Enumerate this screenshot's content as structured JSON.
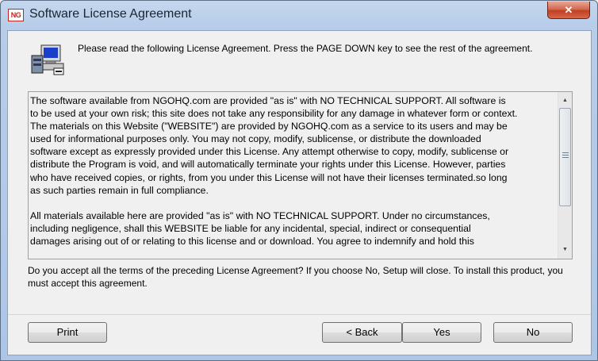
{
  "window": {
    "title": "Software License Agreement",
    "app_icon_text": "NG",
    "close_glyph": "✕"
  },
  "header": {
    "instructions": "Please read the following License Agreement. Press the PAGE DOWN key to see the rest of the agreement."
  },
  "license": {
    "paragraphs": [
      "The software available from NGOHQ.com are provided \"as is\" with NO TECHNICAL SUPPORT. All software is\nto be used at your own risk; this site does not take any responsibility for any damage in whatever form or context.\nThe materials on this Website (\"WEBSITE\") are provided by NGOHQ.com as a service to its users and may be\nused for informational purposes only. You may not copy, modify, sublicense, or distribute the downloaded\nsoftware except as expressly provided under this License. Any attempt otherwise to copy, modify, sublicense or\ndistribute the Program is void, and will automatically terminate your rights under this License. However, parties\nwho have received copies, or rights, from you under this License will not have their licenses terminated.so long\nas such parties remain in full compliance.",
      "All materials available here are provided \"as is\" with NO TECHNICAL SUPPORT. Under no circumstances,\nincluding negligence, shall this WEBSITE be liable for any incidental, special, indirect or consequential\ndamages arising out of or relating to this license and or download. You agree to indemnify and hold this"
    ],
    "scroll_up_glyph": "▲",
    "scroll_down_glyph": "▼"
  },
  "question": "Do you accept all the terms of the preceding License Agreement? If you choose No, Setup will close. To install this product, you must accept this agreement.",
  "buttons": {
    "print": "Print",
    "back": "< Back",
    "yes": "Yes",
    "no": "No"
  }
}
